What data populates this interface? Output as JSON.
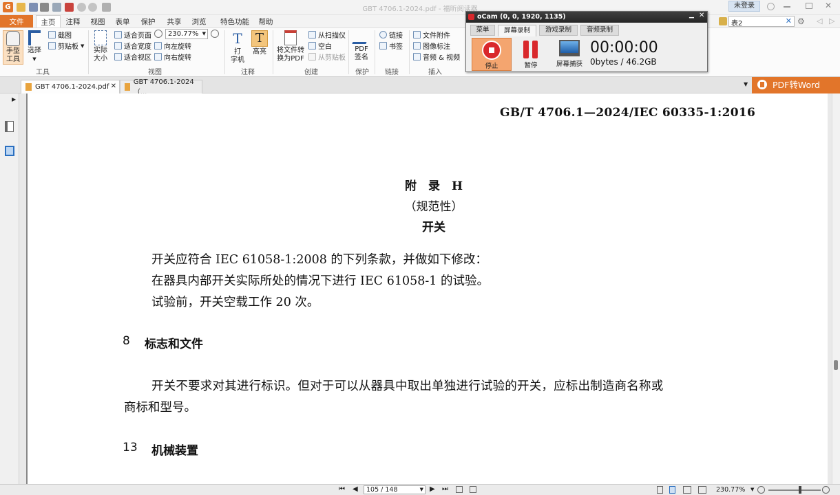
{
  "app": {
    "window_title": "GBT 4706.1-2024.pdf - 福昕阅读器",
    "login_label": "未登录",
    "search_value": "表2"
  },
  "ribbon_tabs": [
    "文件",
    "主页",
    "注释",
    "视图",
    "表单",
    "保护",
    "共享",
    "浏览",
    "特色功能",
    "帮助"
  ],
  "ribbon": {
    "tools": {
      "hand": "手型\n工具",
      "select": "选择",
      "snapshot": "截图",
      "clipboard": "剪贴板",
      "group": "工具"
    },
    "view": {
      "actual_size": "实际\n大小",
      "fit_page": "适合页面",
      "fit_width": "适合宽度",
      "fit_view": "适合视区",
      "zoom": "230.77%",
      "rotate_left": "向左旋转",
      "rotate_right": "向右旋转",
      "group": "视图"
    },
    "annotate": {
      "typewriter": "打\n字机",
      "highlight": "高亮",
      "group": "注释"
    },
    "create": {
      "convert": "将文件转\n换为PDF",
      "from_scanner": "从扫描仪",
      "blank": "空白",
      "from_clipboard": "从剪贴板",
      "group": "创建"
    },
    "protect": {
      "sign": "PDF\n签名",
      "group": "保护"
    },
    "links": {
      "link": "链接",
      "bookmark": "书签",
      "group": "链接"
    },
    "insert": {
      "attachment": "文件附件",
      "image": "图像标注",
      "audio_video": "音频 & 视频",
      "group": "插入"
    }
  },
  "doc_tabs": [
    "GBT 4706.1-2024.pdf",
    "GBT 4706.1-2024（..."
  ],
  "pdf_to_word": "PDF转Word",
  "document": {
    "header": "GB/T 4706.1—2024/IEC 60335-1:2016",
    "appendix_title": "附　录　H",
    "appendix_type": "（规范性）",
    "appendix_subject": "开关",
    "para1_line1": "开关应符合 IEC 61058-1:2008 的下列条款，并做如下修改：",
    "para1_line2": "在器具内部开关实际所处的情况下进行 IEC 61058-1 的试验。",
    "para1_line3": "试验前，开关空载工作 20 次。",
    "section8_num": "8",
    "section8_title": "标志和文件",
    "para2_line1": "开关不要求对其进行标识。但对于可以从器具中取出单独进行试验的开关，应标出制造商名称或",
    "para2_line2": "商标和型号。",
    "section13_num": "13",
    "section13_title": "机械装置"
  },
  "statusbar": {
    "page": "105 / 148",
    "zoom": "230.77%"
  },
  "ocam": {
    "title": "oCam (0, 0, 1920, 1135)",
    "tabs": [
      "菜单",
      "屏幕录制",
      "游戏录制",
      "音频录制"
    ],
    "stop": "停止",
    "pause": "暂停",
    "capture": "屏幕捕获",
    "timer": "00:00:00",
    "size": "0bytes / 46.2GB"
  },
  "colors": {
    "accent": "#e2752a",
    "stop_red": "#d9282c",
    "page_bg": "#ffffff"
  }
}
